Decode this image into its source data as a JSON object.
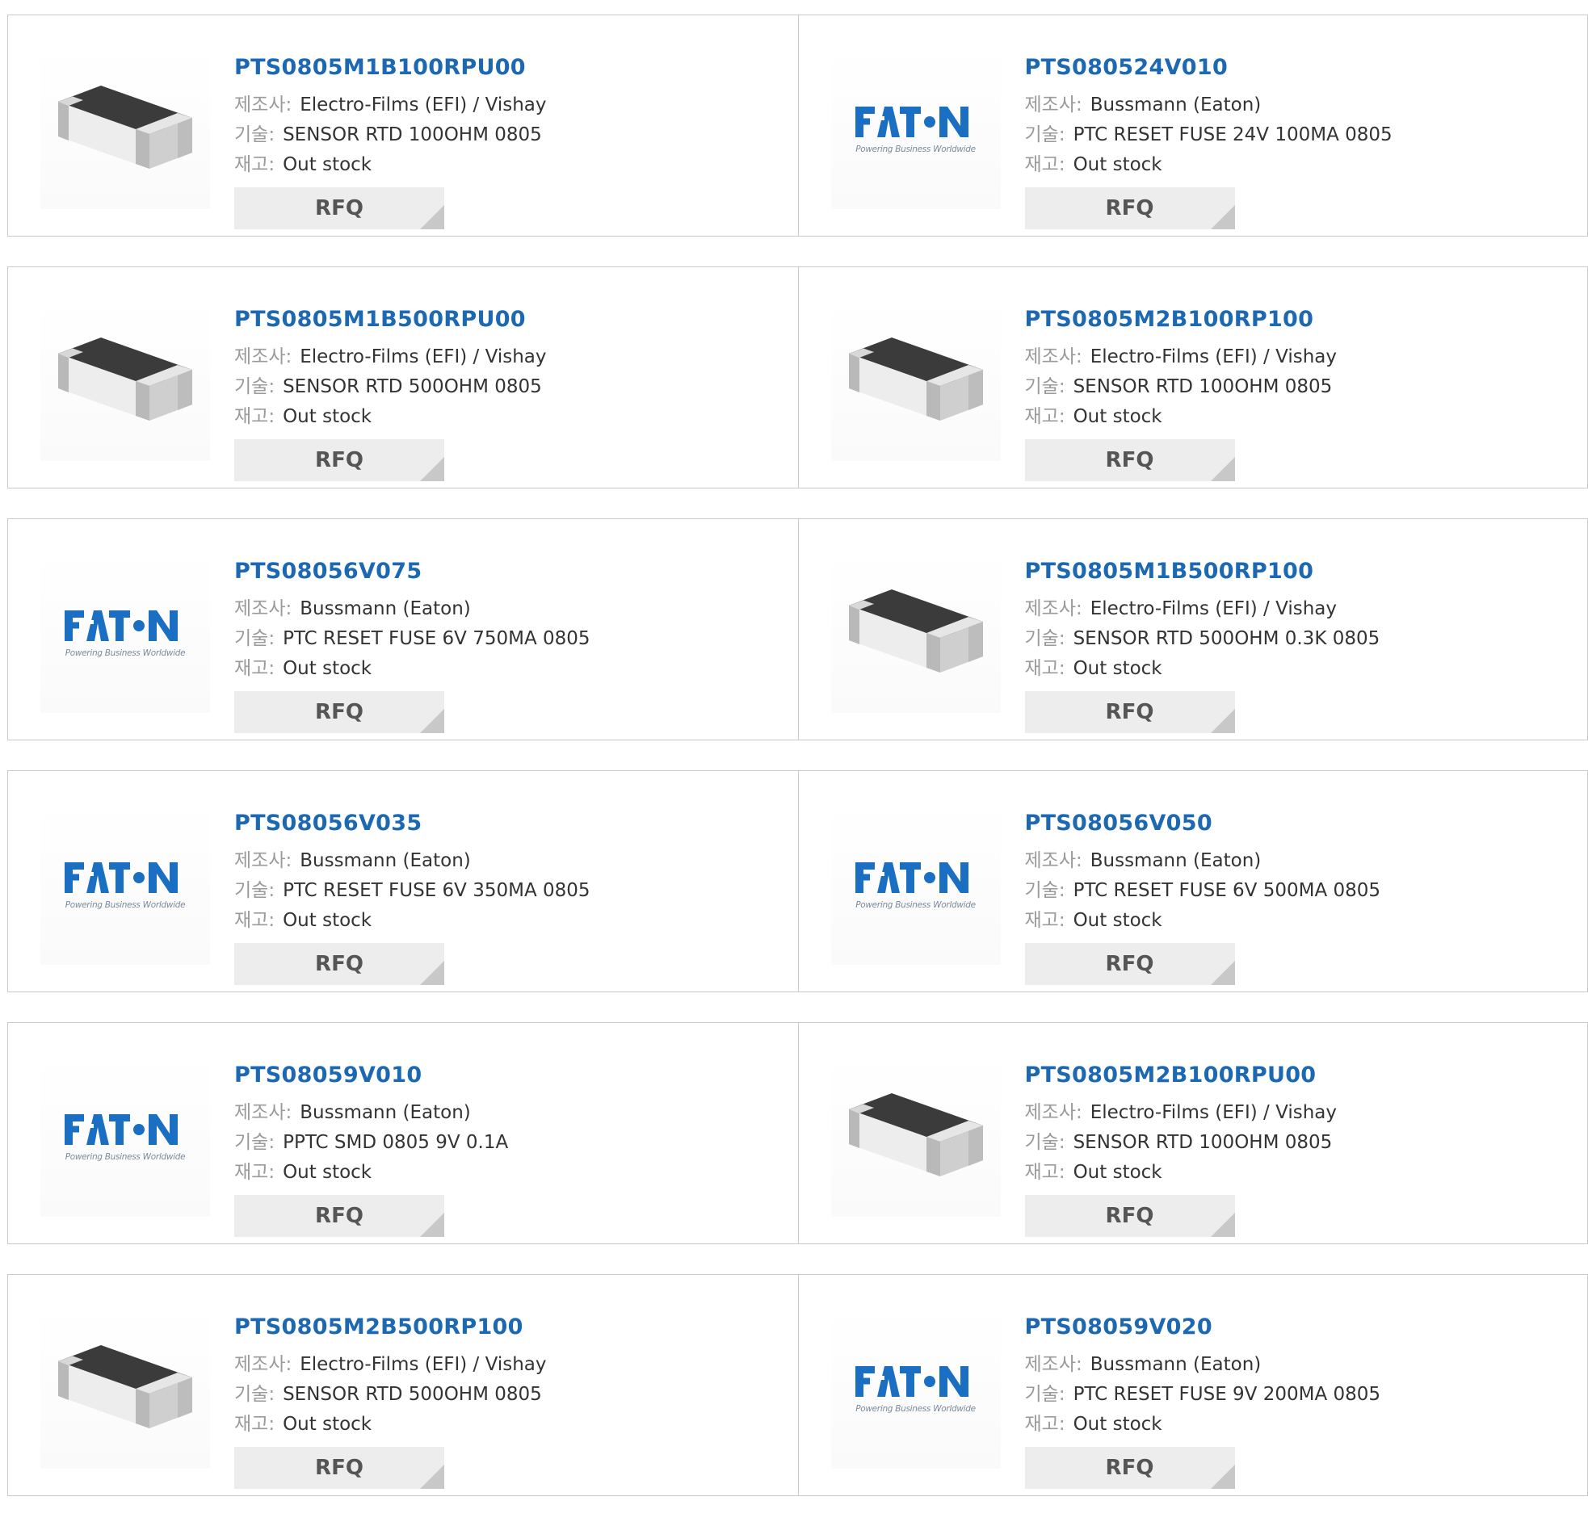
{
  "labels": {
    "manufacturer": "제조사:",
    "description": "기술:",
    "stock": "재고:",
    "rfq": "RFQ"
  },
  "logo": {
    "brand": "EATON",
    "tagline": "Powering Business Worldwide"
  },
  "products": [
    {
      "part": "PTS0805M1B100RPU00",
      "manufacturer": "Electro-Films (EFI) / Vishay",
      "description": "SENSOR RTD 100OHM 0805",
      "stock": "Out stock",
      "image": "chip-resistor-icon"
    },
    {
      "part": "PTS080524V010",
      "manufacturer": "Bussmann (Eaton)",
      "description": "PTC RESET FUSE 24V 100MA 0805",
      "stock": "Out stock",
      "image": "eaton-logo"
    },
    {
      "part": "PTS0805M1B500RPU00",
      "manufacturer": "Electro-Films (EFI) / Vishay",
      "description": "SENSOR RTD 500OHM 0805",
      "stock": "Out stock",
      "image": "chip-resistor-icon"
    },
    {
      "part": "PTS0805M2B100RP100",
      "manufacturer": "Electro-Films (EFI) / Vishay",
      "description": "SENSOR RTD 100OHM 0805",
      "stock": "Out stock",
      "image": "chip-resistor-icon"
    },
    {
      "part": "PTS08056V075",
      "manufacturer": "Bussmann (Eaton)",
      "description": "PTC RESET FUSE 6V 750MA 0805",
      "stock": "Out stock",
      "image": "eaton-logo"
    },
    {
      "part": "PTS0805M1B500RP100",
      "manufacturer": "Electro-Films (EFI) / Vishay",
      "description": "SENSOR RTD 500OHM 0.3K 0805",
      "stock": "Out stock",
      "image": "chip-resistor-icon"
    },
    {
      "part": "PTS08056V035",
      "manufacturer": "Bussmann (Eaton)",
      "description": "PTC RESET FUSE 6V 350MA 0805",
      "stock": "Out stock",
      "image": "eaton-logo"
    },
    {
      "part": "PTS08056V050",
      "manufacturer": "Bussmann (Eaton)",
      "description": "PTC RESET FUSE 6V 500MA 0805",
      "stock": "Out stock",
      "image": "eaton-logo"
    },
    {
      "part": "PTS08059V010",
      "manufacturer": "Bussmann (Eaton)",
      "description": "PPTC SMD 0805 9V 0.1A",
      "stock": "Out stock",
      "image": "eaton-logo"
    },
    {
      "part": "PTS0805M2B100RPU00",
      "manufacturer": "Electro-Films (EFI) / Vishay",
      "description": "SENSOR RTD 100OHM 0805",
      "stock": "Out stock",
      "image": "chip-resistor-icon"
    },
    {
      "part": "PTS0805M2B500RP100",
      "manufacturer": "Electro-Films (EFI) / Vishay",
      "description": "SENSOR RTD 500OHM 0805",
      "stock": "Out stock",
      "image": "chip-resistor-icon"
    },
    {
      "part": "PTS08059V020",
      "manufacturer": "Bussmann (Eaton)",
      "description": "PTC RESET FUSE 9V 200MA 0805",
      "stock": "Out stock",
      "image": "eaton-logo"
    }
  ],
  "colors": {
    "part_link": "#1c68b3",
    "eaton_blue": "#1a6fc2",
    "border": "#c9c9c9",
    "rfq_bg": "#ededed"
  }
}
